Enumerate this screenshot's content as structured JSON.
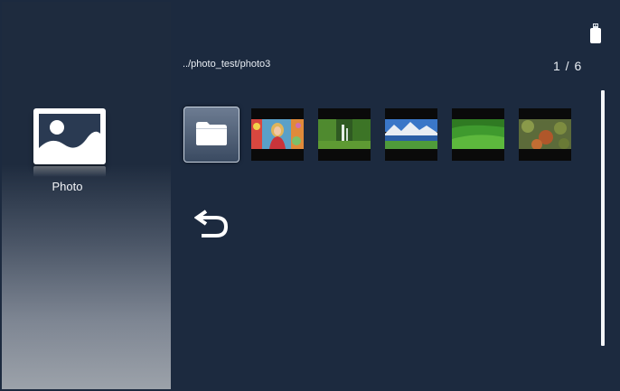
{
  "sidebar": {
    "app_icon": "photo-icon",
    "app_label": "Photo"
  },
  "browser": {
    "path": "../photo_test/photo3",
    "page_counter": "1 / 6",
    "items": [
      {
        "type": "folder",
        "icon": "folder-icon"
      },
      {
        "type": "image",
        "subject": "girl-with-colorful-background"
      },
      {
        "type": "image",
        "subject": "forest-waterfall"
      },
      {
        "type": "image",
        "subject": "mountain-lake"
      },
      {
        "type": "image",
        "subject": "green-field"
      },
      {
        "type": "image",
        "subject": "autumn-trees"
      }
    ],
    "back_icon": "back-arrow-icon"
  },
  "status": {
    "storage_icon": "usb-drive-icon"
  },
  "colors": {
    "background": "#1c2a3f",
    "accent": "#ffffff"
  }
}
